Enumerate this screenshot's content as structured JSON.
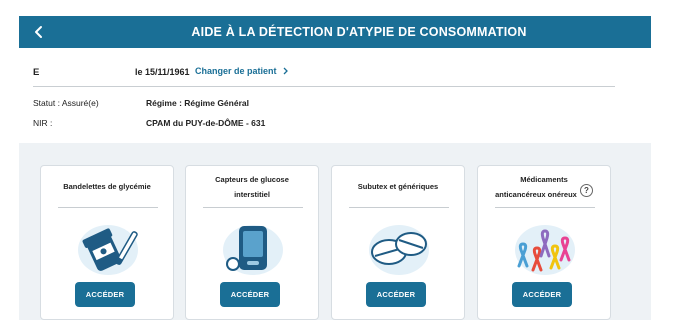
{
  "header": {
    "title": "AIDE À LA DÉTECTION D'ATYPIE DE CONSOMMATION",
    "back_icon": "chevron-left-icon"
  },
  "patient": {
    "initial": "E",
    "dob": "le 15/11/1961",
    "change_label": "Changer de patient"
  },
  "info": {
    "statut": "Statut : Assuré(e)",
    "regime": "Régime : Régime Général",
    "nir": "NIR :",
    "cpam": "CPAM du PUY-de-DÔME - 631"
  },
  "cards": [
    {
      "title_line1": "Bandelettes de glycémie",
      "title_line2": "",
      "button": "ACCÉDER",
      "icon": "glucose-strips-icon"
    },
    {
      "title_line1": "Capteurs de glucose",
      "title_line2": "interstitiel",
      "button": "ACCÉDER",
      "icon": "glucose-sensor-icon"
    },
    {
      "title_line1": "Subutex et génériques",
      "title_line2": "",
      "button": "ACCÉDER",
      "icon": "pills-icon"
    },
    {
      "title_line1": "Médicaments",
      "title_line2": "anticancéreux onéreux",
      "button": "ACCÉDER",
      "icon": "ribbons-icon",
      "help": "?"
    }
  ],
  "colors": {
    "brand": "#1a6f96",
    "panel": "#eef2f5"
  }
}
